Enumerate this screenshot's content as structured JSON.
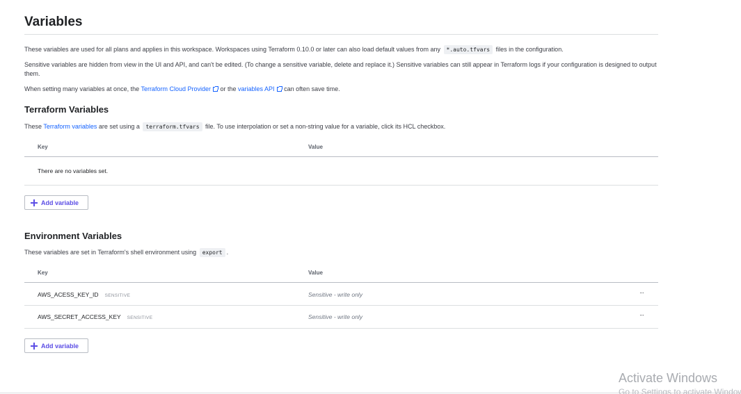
{
  "page": {
    "title": "Variables"
  },
  "intro": {
    "p1_before": "These variables are used for all plans and applies in this workspace. Workspaces using Terraform 0.10.0 or later can also load default values from any",
    "p1_code": "*.auto.tfvars",
    "p1_after": "files in the configuration.",
    "p2": "Sensitive variables are hidden from view in the UI and API, and can't be edited. (To change a sensitive variable, delete and replace it.) Sensitive variables can still appear in Terraform logs if your configuration is designed to output them.",
    "p3_before": "When setting many variables at once, the",
    "p3_link1": "Terraform Cloud Provider",
    "p3_mid": "or the",
    "p3_link2": "variables API",
    "p3_after": "can often save time."
  },
  "terraform_vars": {
    "title": "Terraform Variables",
    "desc_before": "These",
    "desc_link": "Terraform variables",
    "desc_mid": "are set using a",
    "desc_code": "terraform.tfvars",
    "desc_after": "file. To use interpolation or set a non-string value for a variable, click its HCL checkbox.",
    "col_key": "Key",
    "col_value": "Value",
    "empty_text": "There are no variables set.",
    "add_label": "Add variable"
  },
  "env_vars": {
    "title": "Environment Variables",
    "desc_before": "These variables are set in Terraform's shell environment using",
    "desc_code": "export",
    "desc_after": ".",
    "col_key": "Key",
    "col_value": "Value",
    "rows": [
      {
        "key": "AWS_ACESS_KEY_ID",
        "badge": "SENSITIVE",
        "value": "Sensitive - write only",
        "menu": "···"
      },
      {
        "key": "AWS_SECRET_ACCESS_KEY",
        "badge": "SENSITIVE",
        "value": "Sensitive - write only",
        "menu": "···"
      }
    ],
    "add_label": "Add variable"
  },
  "watermark": {
    "title": "Activate Windows",
    "subtitle": "Go to Settings to activate Windows."
  }
}
